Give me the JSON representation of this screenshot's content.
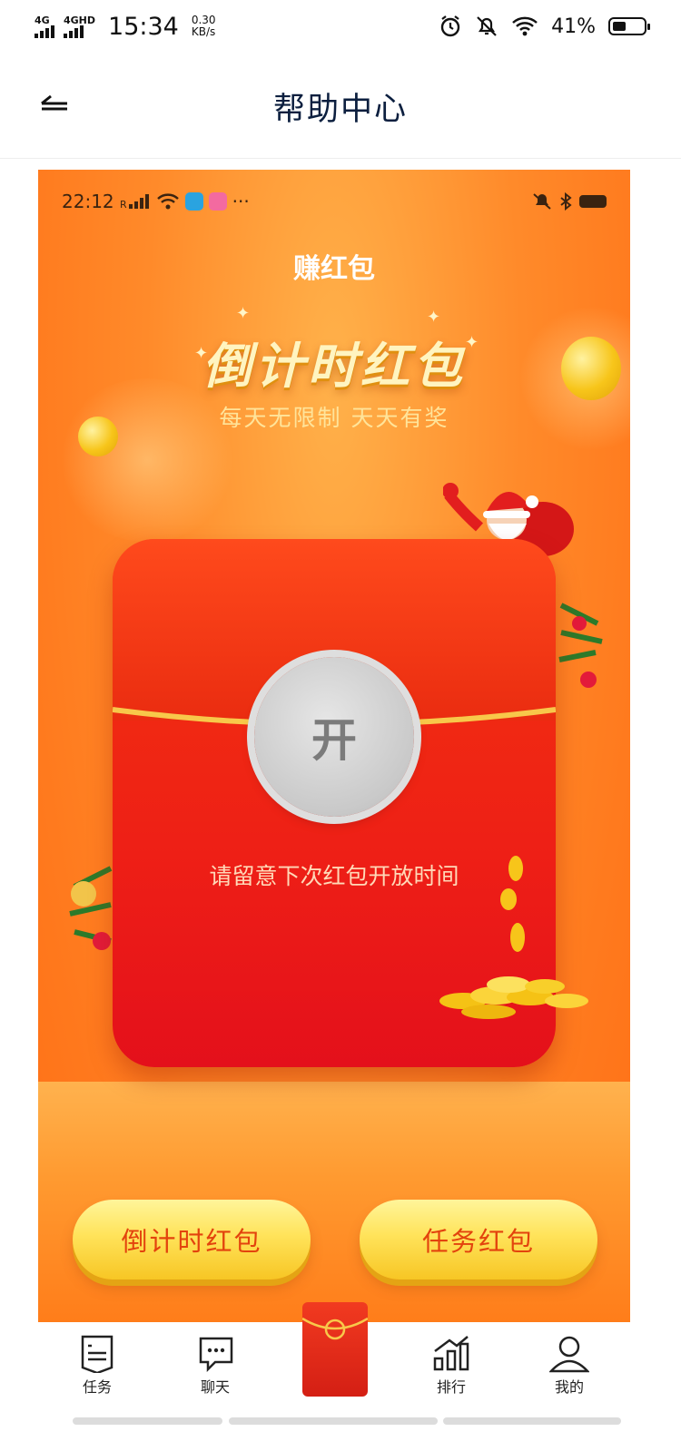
{
  "status_bar": {
    "net1": "4G",
    "net2": "4GHD",
    "time": "15:34",
    "speed_value": "0.30",
    "speed_unit": "KB/s",
    "battery": "41%",
    "battery_level": 0.41
  },
  "header": {
    "title": "帮助中心"
  },
  "poster": {
    "inner_status": {
      "time": "22:12",
      "more": "···"
    },
    "title": "赚红包",
    "banner_title": "倒计时红包",
    "banner_subtitle": "每天无限制 天天有奖",
    "open_label": "开",
    "message": "请留意下次红包开放时间",
    "buttons": {
      "countdown": "倒计时红包",
      "task": "任务红包"
    }
  },
  "tabbar": {
    "items": [
      {
        "label": "任务",
        "icon": "task-list-icon"
      },
      {
        "label": "聊天",
        "icon": "chat-bubble-icon"
      },
      {
        "label": "",
        "icon": "red-envelope-icon"
      },
      {
        "label": "排行",
        "icon": "ranking-chart-icon"
      },
      {
        "label": "我的",
        "icon": "user-profile-icon"
      }
    ]
  },
  "colors": {
    "accent": "#ff7a1e",
    "envelope": "#ee1f16",
    "button": "#ffe35a",
    "button_text": "#e3430d",
    "header_text": "#0c1f3f"
  }
}
